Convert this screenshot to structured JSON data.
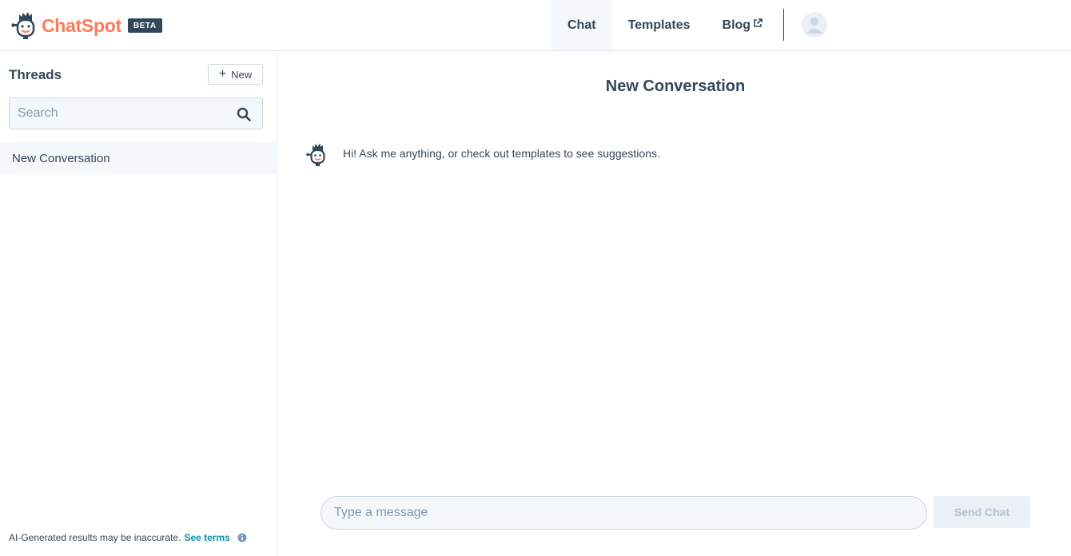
{
  "header": {
    "brand": "ChatSpot",
    "badge": "BETA",
    "nav": {
      "chat": "Chat",
      "templates": "Templates",
      "blog": "Blog"
    },
    "active_tab": "Chat"
  },
  "sidebar": {
    "title": "Threads",
    "new_button_label": "New",
    "search_placeholder": "Search",
    "threads": [
      {
        "label": "New Conversation",
        "selected": true
      }
    ],
    "disclaimer": "AI-Generated results may be inaccurate.",
    "terms_link": "See terms"
  },
  "main": {
    "title": "New Conversation",
    "bot_greeting": "Hi! Ask me anything, or check out templates to see suggestions.",
    "input_placeholder": "Type a message",
    "send_label": "Send Chat"
  },
  "colors": {
    "brand_orange": "#ff7a59",
    "text_primary": "#33475b",
    "link": "#0091ae",
    "input_bg": "#f5f8fa",
    "border": "#cbd6e2"
  }
}
